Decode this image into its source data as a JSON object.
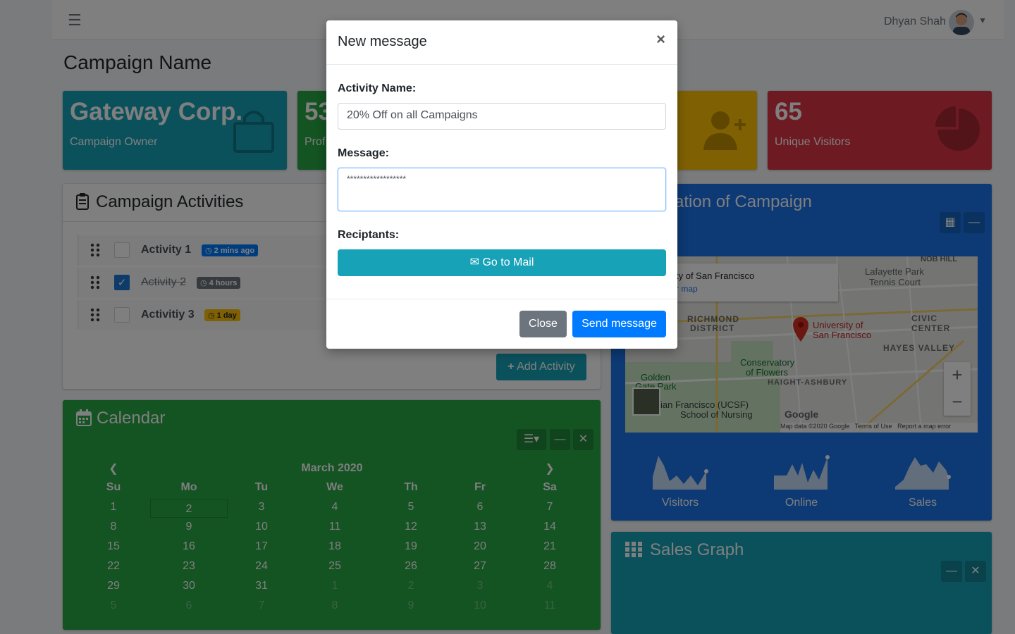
{
  "header": {
    "user_name": "Dhyan Shah"
  },
  "page": {
    "title": "Campaign Name"
  },
  "stats": [
    {
      "value": "Gateway Corp.",
      "label": "Campaign Owner",
      "color": "#17a2b8",
      "icon": "shopping-bag-icon"
    },
    {
      "value": "53",
      "label": "Prof",
      "color": "#28a745",
      "icon": "chart-icon"
    },
    {
      "value": "",
      "label": "",
      "color": "#ffc107",
      "icon": "user-plus-icon"
    },
    {
      "value": "65",
      "label": "Unique Visitors",
      "color": "#dc3545",
      "icon": "pie-chart-icon"
    }
  ],
  "activities": {
    "title": "Campaign Activities",
    "items": [
      {
        "name": "Activity 1",
        "badge": "2 mins ago",
        "badge_color": "#007bff",
        "done": false
      },
      {
        "name": "Activity 2",
        "badge": "4 hours",
        "badge_color": "#6c757d",
        "done": true
      },
      {
        "name": "Activitiy 3",
        "badge": "1 day",
        "badge_color": "#ffc107",
        "done": false
      }
    ],
    "add_label": "Add Activity"
  },
  "calendar": {
    "title": "Calendar",
    "month": "March 2020",
    "weekdays": [
      "Su",
      "Mo",
      "Tu",
      "We",
      "Th",
      "Fr",
      "Sa"
    ],
    "rows": [
      [
        "1",
        "2",
        "3",
        "4",
        "5",
        "6",
        "7"
      ],
      [
        "8",
        "9",
        "10",
        "11",
        "12",
        "13",
        "14"
      ],
      [
        "15",
        "16",
        "17",
        "18",
        "19",
        "20",
        "21"
      ],
      [
        "22",
        "23",
        "24",
        "25",
        "26",
        "27",
        "28"
      ],
      [
        "29",
        "30",
        "31",
        "1",
        "2",
        "3",
        "4"
      ],
      [
        "5",
        "6",
        "7",
        "8",
        "9",
        "10",
        "11"
      ]
    ],
    "selected": "2"
  },
  "location": {
    "title": "ation of Campaign",
    "map_place": "ty of San Francisco",
    "map_link": "r map",
    "map_labels": [
      "NOB HILL",
      "Lafayette Park",
      "Tennis Court",
      "RICHMOND",
      "DISTRICT",
      "University of",
      "San Francisco",
      "CIVIC CENTER",
      "HAYES VALLEY",
      "Conservatory",
      "of Flowers",
      "HAIGHT-ASHBURY",
      "Golden",
      "Gate Park",
      "ian Francisco (UCSF)",
      "School of Nursing"
    ],
    "map_footer": "Map data ©2020 Google",
    "map_terms": "Terms of Use",
    "map_report": "Report a map error",
    "sparks": [
      "Visitors",
      "Online",
      "Sales"
    ]
  },
  "sales": {
    "title": "Sales Graph"
  },
  "modal": {
    "title": "New message",
    "close_x": "×",
    "activity_label": "Activity Name:",
    "activity_value": "20% Off on all Campaigns",
    "message_label": "Message:",
    "message_value": "******************",
    "recipients_label": "Reciptants:",
    "mail_button": "Go to Mail",
    "close_button": "Close",
    "send_button": "Send message"
  }
}
